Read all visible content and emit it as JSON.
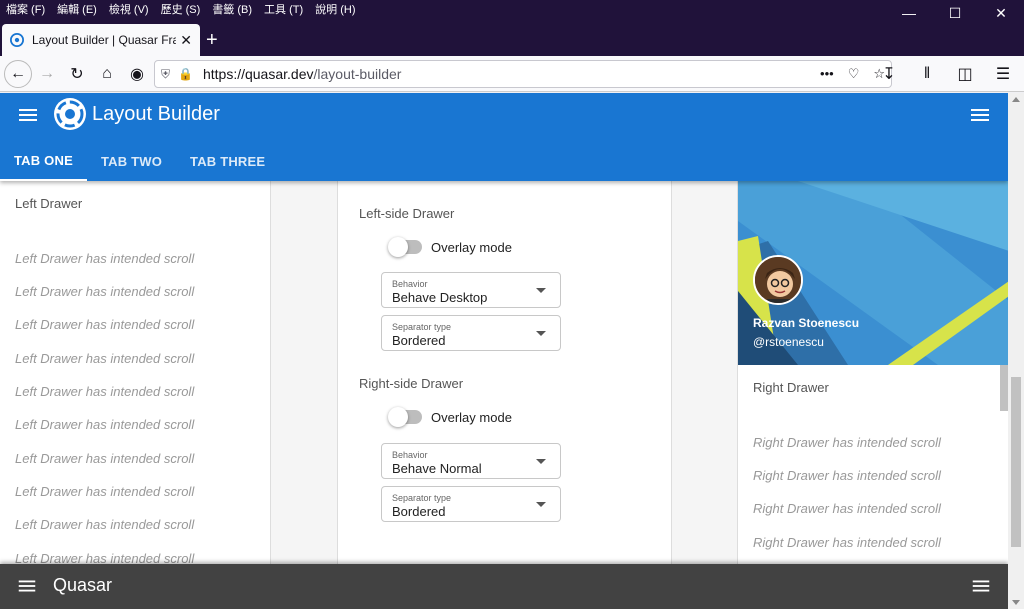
{
  "os_menu": {
    "items": [
      "檔案 (F)",
      "編輯 (E)",
      "檢視 (V)",
      "歷史 (S)",
      "書籤 (B)",
      "工具 (T)",
      "說明 (H)"
    ]
  },
  "browser": {
    "tab_title": "Layout Builder | Quasar Frame",
    "url_host": "https://quasar.dev",
    "url_path": "/layout-builder"
  },
  "header": {
    "title": "Layout Builder",
    "tabs": [
      "TAB ONE",
      "TAB TWO",
      "TAB THREE"
    ],
    "active_tab": 0
  },
  "left_drawer": {
    "title": "Left Drawer",
    "items": [
      "Left Drawer has intended scroll",
      "Left Drawer has intended scroll",
      "Left Drawer has intended scroll",
      "Left Drawer has intended scroll",
      "Left Drawer has intended scroll",
      "Left Drawer has intended scroll",
      "Left Drawer has intended scroll",
      "Left Drawer has intended scroll",
      "Left Drawer has intended scroll",
      "Left Drawer has intended scroll"
    ]
  },
  "settings": {
    "left": {
      "title": "Left-side Drawer",
      "overlay_label": "Overlay mode",
      "behavior_label": "Behavior",
      "behavior_value": "Behave Desktop",
      "separator_label": "Separator type",
      "separator_value": "Bordered"
    },
    "right": {
      "title": "Right-side Drawer",
      "overlay_label": "Overlay mode",
      "behavior_label": "Behavior",
      "behavior_value": "Behave Normal",
      "separator_label": "Separator type",
      "separator_value": "Bordered"
    }
  },
  "right_drawer": {
    "name": "Razvan Stoenescu",
    "handle": "@rstoenescu",
    "title": "Right Drawer",
    "items": [
      "Right Drawer has intended scroll",
      "Right Drawer has intended scroll",
      "Right Drawer has intended scroll",
      "Right Drawer has intended scroll"
    ]
  },
  "footer": {
    "title": "Quasar"
  },
  "colors": {
    "header": "#1976d2",
    "footer": "#424242",
    "browser_chrome": "#20123a"
  }
}
